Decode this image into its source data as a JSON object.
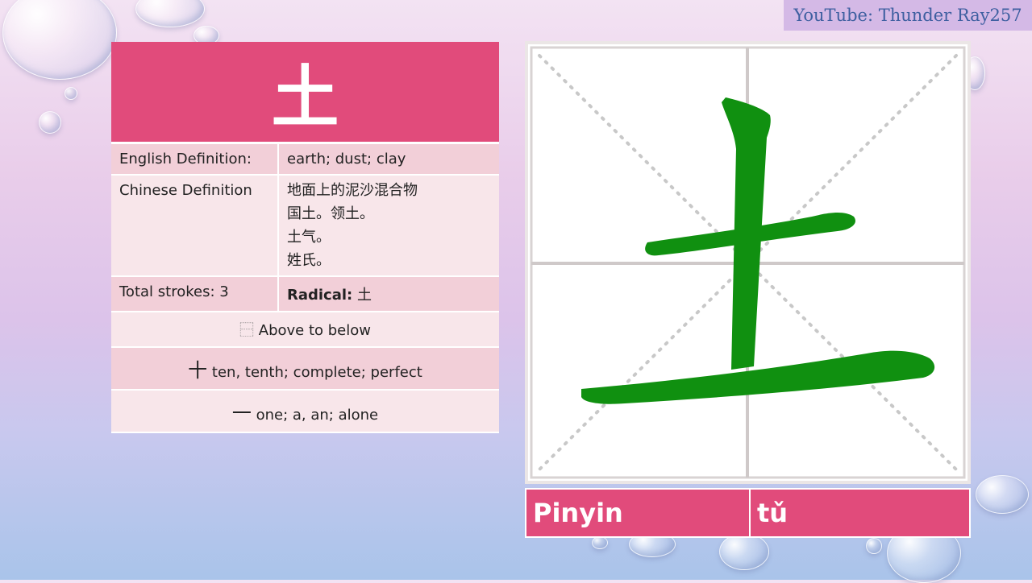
{
  "watermark": "YouTube: Thunder Ray257",
  "character": "土",
  "table": {
    "english_label": "English Definition:",
    "english_value": "earth; dust; clay",
    "chinese_label": "Chinese Definition",
    "chinese_lines": [
      "地面上的泥沙混合物",
      "国土。领土。",
      "土气。",
      "姓氏。"
    ],
    "strokes_label": "Total strokes: 3",
    "radical_label": "Radical:",
    "radical_value": "土",
    "structure_icon": "⿱",
    "structure_text": "Above to below",
    "component1_char": "十",
    "component1_text": "ten, tenth; complete; perfect",
    "component2_char": "一",
    "component2_text": "one; a, an; alone"
  },
  "pinyin": {
    "label": "Pinyin",
    "value": "tǔ"
  },
  "colors": {
    "accent": "#e14b7b",
    "stroke": "#109010",
    "guide": "#cccccc"
  }
}
